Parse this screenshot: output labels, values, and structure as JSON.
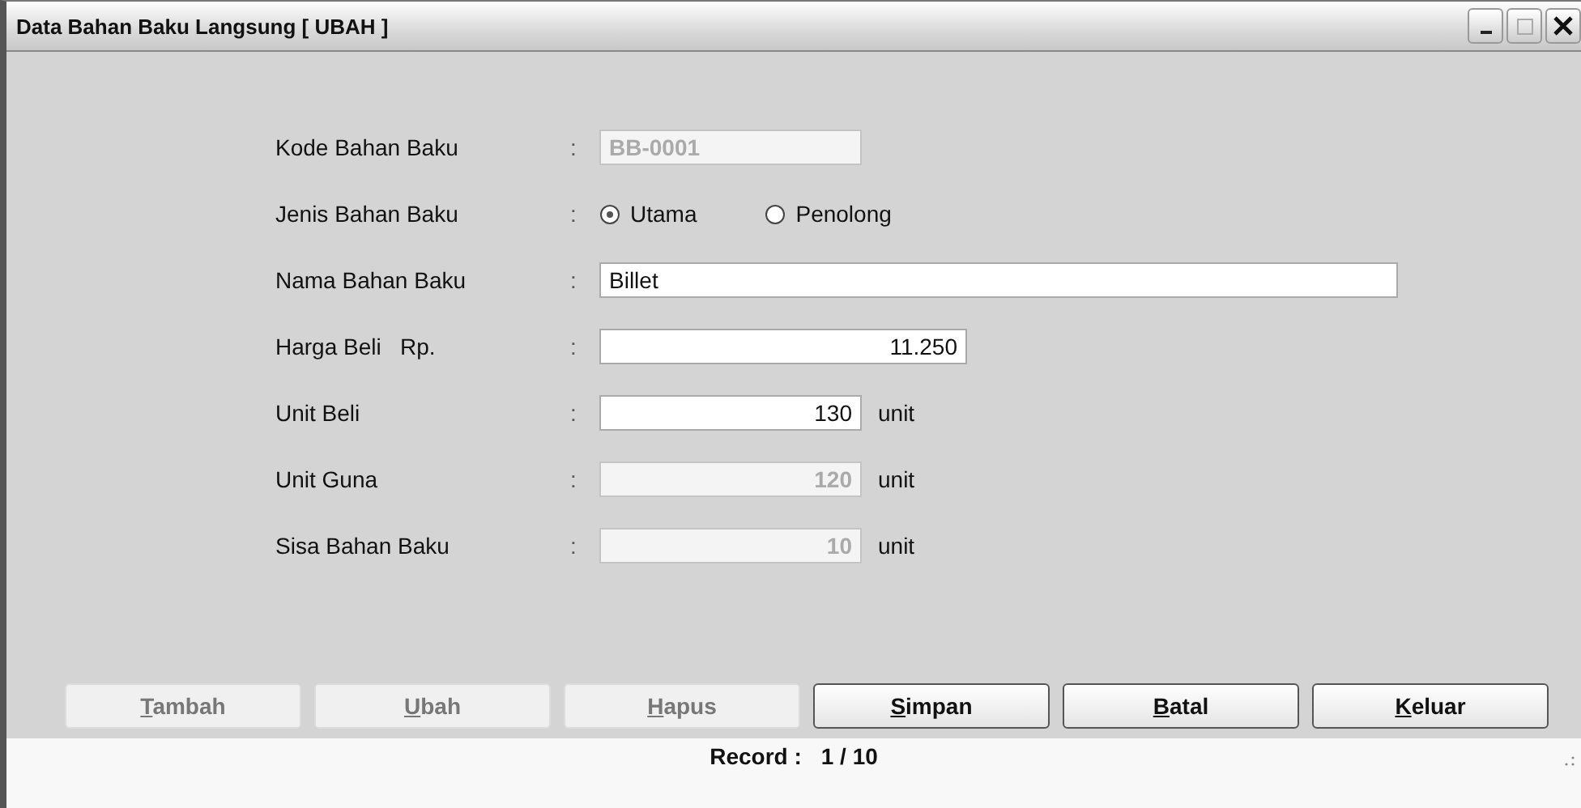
{
  "window": {
    "title": "Data Bahan Baku Langsung [ UBAH ]"
  },
  "fields": [
    {
      "kind": "text",
      "label": "Kode Bahan Baku",
      "separator": ":",
      "value": "BB-0001",
      "disabled": true
    },
    {
      "kind": "radio",
      "label": "Jenis Bahan Baku",
      "separator": ":",
      "options": [
        {
          "label": "Utama",
          "selected": true
        },
        {
          "label": "Penolong",
          "selected": false
        }
      ]
    },
    {
      "kind": "text",
      "label": "Nama Bahan Baku",
      "separator": ":",
      "value": "Billet",
      "disabled": false
    },
    {
      "kind": "number",
      "label": "Harga Beli   Rp.",
      "separator": ":",
      "value": "11.250",
      "disabled": false
    },
    {
      "kind": "number",
      "label": "Unit Beli",
      "separator": ":",
      "value": "130",
      "disabled": false,
      "suffix": "unit"
    },
    {
      "kind": "number",
      "label": "Unit Guna",
      "separator": ":",
      "value": "120",
      "disabled": true,
      "suffix": "unit"
    },
    {
      "kind": "number",
      "label": "Sisa Bahan Baku",
      "separator": ":",
      "value": "10",
      "disabled": true,
      "suffix": "unit"
    }
  ],
  "buttons": [
    {
      "label": "Tambah",
      "disabled": true
    },
    {
      "label": "Ubah",
      "disabled": true
    },
    {
      "label": "Hapus",
      "disabled": true
    },
    {
      "label": "Simpan",
      "disabled": false
    },
    {
      "label": "Batal",
      "disabled": false
    },
    {
      "label": "Keluar",
      "disabled": false
    }
  ],
  "status_bar": {
    "label": "Record :",
    "value": "1 / 10"
  }
}
